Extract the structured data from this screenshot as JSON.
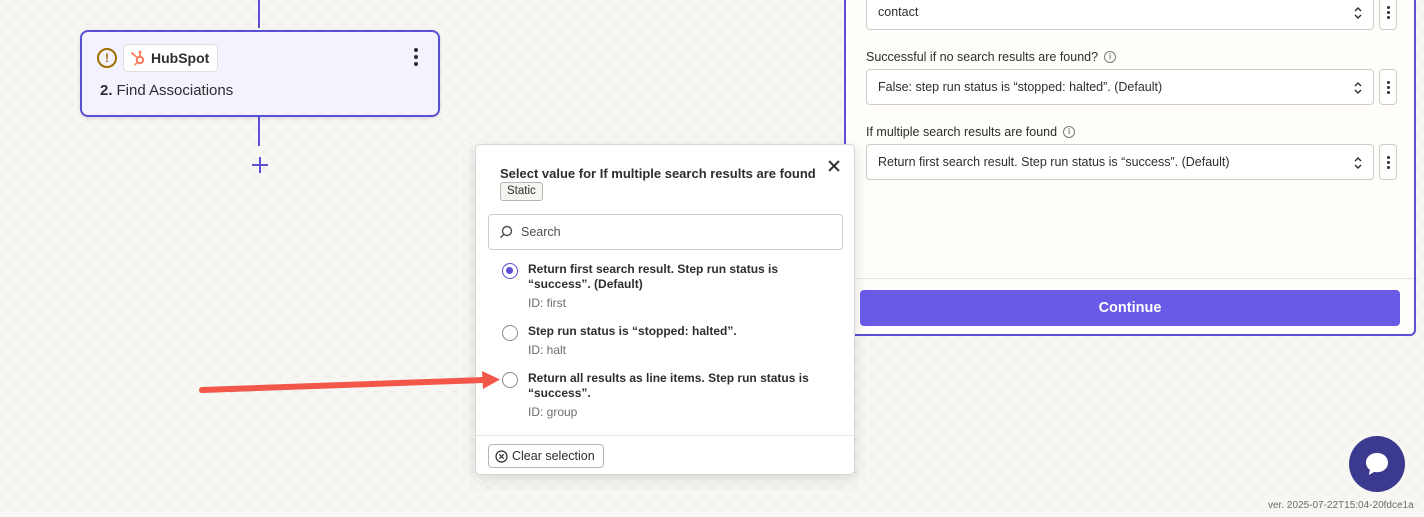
{
  "canvas": {
    "step": {
      "number": "2.",
      "app_name": "HubSpot",
      "action": "Find Associations",
      "warning_glyph": "!"
    }
  },
  "panel": {
    "object_type": {
      "value": "contact"
    },
    "no_results": {
      "label": "Successful if no search results are found?",
      "value": "False: step run status is “stopped: halted”. (Default)"
    },
    "multiple_results": {
      "label": "If multiple search results are found",
      "value": "Return first search result. Step run status is “success”. (Default)"
    },
    "continue_label": "Continue"
  },
  "popup": {
    "title": "Select value for If multiple search results are found",
    "badge": "Static",
    "search_placeholder": "Search",
    "options": [
      {
        "label": "Return first search result. Step run status is “success”. (Default)",
        "id": "ID: first",
        "selected": true
      },
      {
        "label": "Step run status is “stopped: halted”.",
        "id": "ID: halt",
        "selected": false
      },
      {
        "label": "Return all results as line items. Step run status is “success”.",
        "id": "ID: group",
        "selected": false
      }
    ],
    "clear_label": "Clear selection"
  },
  "footer": {
    "version": "ver. 2025-07-22T15:04-20fdce1a"
  },
  "colors": {
    "accent": "#5b4fd6",
    "button": "#695be8",
    "annotation_arrow": "#f2574a",
    "hubspot": "#ff7a59",
    "warning": "#a26d00",
    "chat": "#3b3a8e"
  }
}
